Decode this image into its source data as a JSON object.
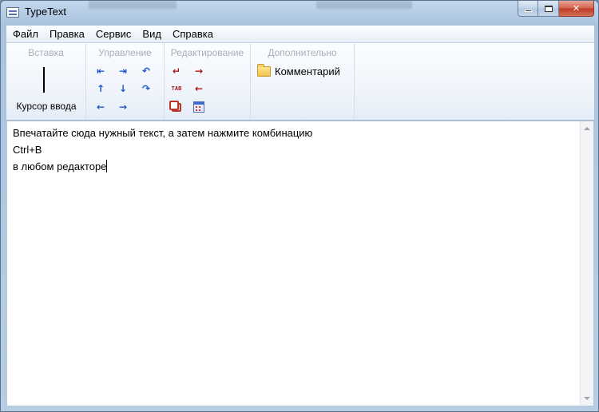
{
  "window": {
    "title": "TypeText"
  },
  "menubar": {
    "items": [
      {
        "label": "Файл"
      },
      {
        "label": "Правка"
      },
      {
        "label": "Сервис"
      },
      {
        "label": "Вид"
      },
      {
        "label": "Справка"
      }
    ]
  },
  "ribbon": {
    "groups": {
      "insert": {
        "title": "Вставка",
        "cursor_label": "Курсор ввода"
      },
      "control": {
        "title": "Управление"
      },
      "editing": {
        "title": "Редактирование"
      },
      "extra": {
        "title": "Дополнительно",
        "comment_label": "Комментарий"
      }
    },
    "control_icons": [
      "home-icon",
      "end-icon",
      "undo-icon",
      "arrow-up-icon",
      "arrow-down-icon",
      "redo-icon",
      "arrow-left-icon",
      "arrow-right-icon"
    ],
    "editing_icons": [
      "enter-icon",
      "arrow-right-red-icon",
      "tab-icon",
      "backspace-icon",
      "copy-icon",
      "calendar-icon"
    ]
  },
  "editor": {
    "lines": [
      "Впечатайте сюда нужный текст, а затем нажмите комбинацию",
      "Ctrl+B",
      "в любом редакторе"
    ]
  },
  "colors": {
    "accent_blue": "#1d56c9",
    "accent_red": "#a4161b"
  }
}
